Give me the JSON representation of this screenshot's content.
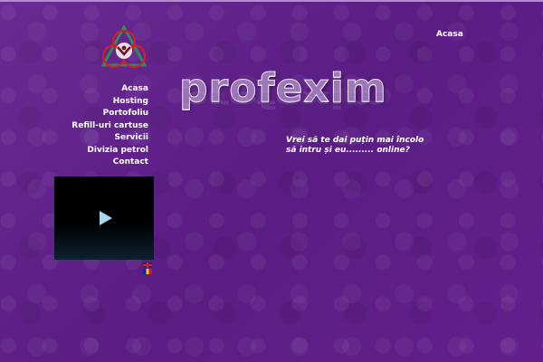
{
  "header": {
    "top_link": "Acasa",
    "brand": "profexim"
  },
  "sidebar": {
    "items": [
      {
        "label": "Acasa"
      },
      {
        "label": "Hosting"
      },
      {
        "label": "Portofoliu"
      },
      {
        "label": "Refill-uri cartuse"
      },
      {
        "label": "Servicii"
      },
      {
        "label": "Divizia petrol"
      },
      {
        "label": "Contact"
      }
    ]
  },
  "main": {
    "tagline_line1": "Vrei să te dai puțin mai încolo",
    "tagline_line2": "să intru și eu......... online?"
  },
  "languages": [
    {
      "icon": "flag-en-icon"
    },
    {
      "icon": "flag-ro-icon"
    }
  ],
  "colors": {
    "background": "#5e1f86",
    "text": "#ffffff"
  }
}
